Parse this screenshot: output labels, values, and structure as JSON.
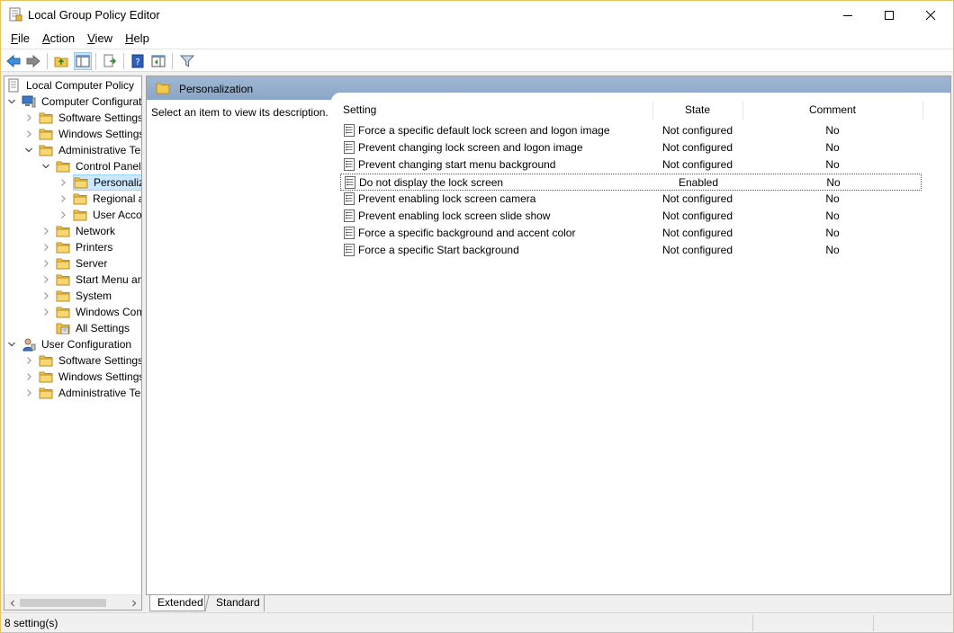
{
  "window": {
    "title": "Local Group Policy Editor"
  },
  "menu": [
    {
      "label_ul": "F",
      "label_rest": "ile"
    },
    {
      "label_ul": "A",
      "label_rest": "ction"
    },
    {
      "label_ul": "V",
      "label_rest": "iew"
    },
    {
      "label_ul": "H",
      "label_rest": "elp"
    }
  ],
  "tree": {
    "items": [
      {
        "label": "Local Computer Policy",
        "icon": "policy-doc-icon"
      },
      {
        "label": "Computer Configuration",
        "icon": "computer-icon"
      },
      {
        "label": "Software Settings",
        "icon": "folder-icon"
      },
      {
        "label": "Windows Settings",
        "icon": "folder-icon"
      },
      {
        "label": "Administrative Templates",
        "icon": "folder-icon"
      },
      {
        "label": "Control Panel",
        "icon": "folder-icon"
      },
      {
        "label": "Personalization",
        "icon": "folder-icon"
      },
      {
        "label": "Regional and Language Options",
        "icon": "folder-icon"
      },
      {
        "label": "User Accounts",
        "icon": "folder-icon"
      },
      {
        "label": "Network",
        "icon": "folder-icon"
      },
      {
        "label": "Printers",
        "icon": "folder-icon"
      },
      {
        "label": "Server",
        "icon": "folder-icon"
      },
      {
        "label": "Start Menu and Taskbar",
        "icon": "folder-icon"
      },
      {
        "label": "System",
        "icon": "folder-icon"
      },
      {
        "label": "Windows Components",
        "icon": "folder-icon"
      },
      {
        "label": "All Settings",
        "icon": "all-settings-icon"
      },
      {
        "label": "User Configuration",
        "icon": "user-icon"
      },
      {
        "label": "Software Settings",
        "icon": "folder-icon"
      },
      {
        "label": "Windows Settings",
        "icon": "folder-icon"
      },
      {
        "label": "Administrative Templates",
        "icon": "folder-icon"
      }
    ]
  },
  "right": {
    "header": "Personalization",
    "description": "Select an item to view its description.",
    "columns": {
      "setting": "Setting",
      "state": "State",
      "comment": "Comment"
    },
    "rows": [
      {
        "setting": "Force a specific default lock screen and logon image",
        "state": "Not configured",
        "comment": "No"
      },
      {
        "setting": "Prevent changing lock screen and logon image",
        "state": "Not configured",
        "comment": "No"
      },
      {
        "setting": "Prevent changing start menu background",
        "state": "Not configured",
        "comment": "No"
      },
      {
        "setting": "Do not display the lock screen",
        "state": "Enabled",
        "comment": "No"
      },
      {
        "setting": "Prevent enabling lock screen camera",
        "state": "Not configured",
        "comment": "No"
      },
      {
        "setting": "Prevent enabling lock screen slide show",
        "state": "Not configured",
        "comment": "No"
      },
      {
        "setting": "Force a specific background and accent color",
        "state": "Not configured",
        "comment": "No"
      },
      {
        "setting": "Force a specific Start background",
        "state": "Not configured",
        "comment": "No"
      }
    ]
  },
  "tabs": {
    "extended": "Extended",
    "standard": "Standard"
  },
  "status": {
    "text": "8 setting(s)"
  },
  "colors": {
    "header_band": "#8aa6c7",
    "selection": "#cce8ff",
    "folder": "#f2c94c"
  }
}
